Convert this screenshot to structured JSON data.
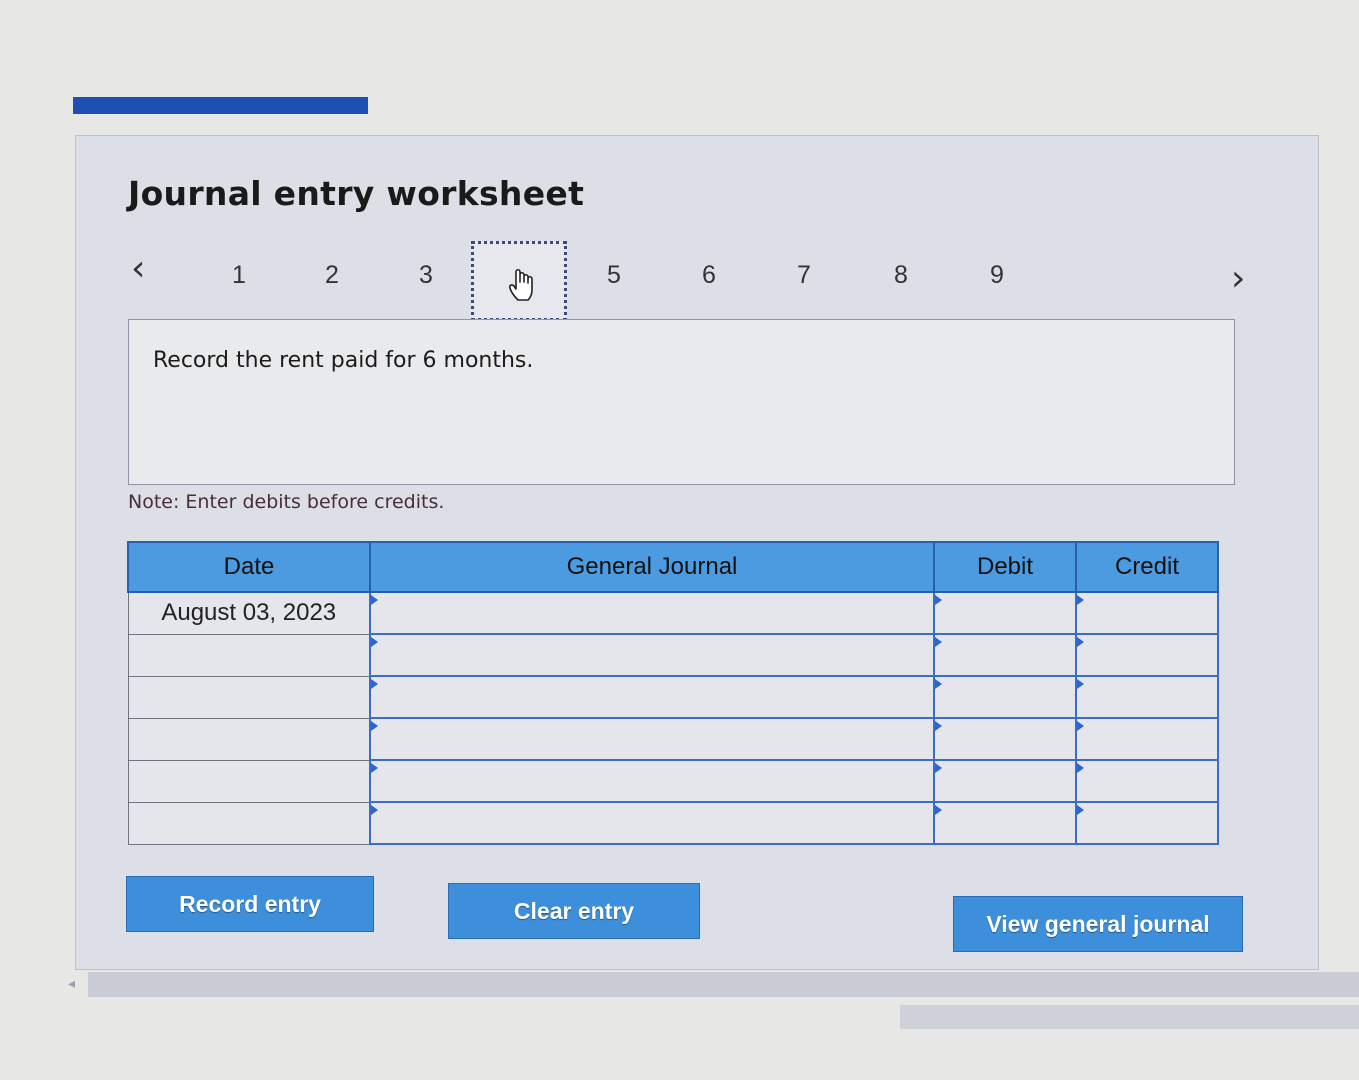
{
  "worksheet": {
    "title": "Journal entry worksheet",
    "prompt": "Record the rent paid for 6 months.",
    "note": "Note: Enter debits before credits."
  },
  "stepper": {
    "prev_label": "‹",
    "next_label": "›",
    "active_step": 4,
    "steps": [
      "1",
      "2",
      "3",
      "4",
      "5",
      "6",
      "7",
      "8",
      "9"
    ]
  },
  "journal": {
    "headers": {
      "date": "Date",
      "general_journal": "General Journal",
      "debit": "Debit",
      "credit": "Credit"
    },
    "rows": [
      {
        "date": "August 03, 2023",
        "account": "",
        "debit": "",
        "credit": ""
      },
      {
        "date": "",
        "account": "",
        "debit": "",
        "credit": ""
      },
      {
        "date": "",
        "account": "",
        "debit": "",
        "credit": ""
      },
      {
        "date": "",
        "account": "",
        "debit": "",
        "credit": ""
      },
      {
        "date": "",
        "account": "",
        "debit": "",
        "credit": ""
      },
      {
        "date": "",
        "account": "",
        "debit": "",
        "credit": ""
      }
    ]
  },
  "buttons": {
    "record": "Record entry",
    "clear": "Clear entry",
    "view": "View general journal"
  },
  "colors": {
    "accent": "#1d4fb4",
    "header_blue": "#4c9ae0",
    "button_blue": "#3d8fdc"
  }
}
